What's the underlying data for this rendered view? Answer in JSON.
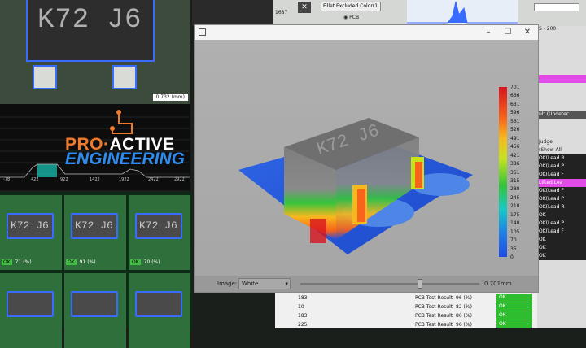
{
  "camera": {
    "chip_marking": "K72 J6",
    "scale_label": "0.732 (mm)"
  },
  "graph": {
    "brand_part1": "PRO",
    "brand_dot": "·",
    "brand_part2": "ACTIVE",
    "brand_line2": "ENGINEERING",
    "axis_ticks": [
      "-78",
      "422",
      "922",
      "1422",
      "1922",
      "2422",
      "2922"
    ]
  },
  "thumbnails": [
    {
      "marking": "K72 J6",
      "score": "71 (%)",
      "status": "OK"
    },
    {
      "marking": "K72 J6",
      "score": "91 (%)",
      "status": "OK"
    },
    {
      "marking": "K72 J6",
      "score": "70 (%)",
      "status": "OK"
    }
  ],
  "background_app": {
    "field_label": "Fillet Excluded Color(1",
    "radio_label": "PCB",
    "code": "1687",
    "range_label": "S - 200"
  },
  "right_panel": {
    "items": [
      "ult (Undetec",
      "Judge",
      "(Show All",
      "OK(Lead R",
      "OK(Lead P",
      "OK(Lead F",
      "Lifted Lea",
      "OK(Lead F",
      "OK(Lead P",
      "OK(Lead R",
      "OK",
      "OK(Lead P",
      "OK(Lead F",
      "OK",
      "OK",
      "OK"
    ]
  },
  "viewer": {
    "window_controls": [
      "–",
      "☐",
      "✕"
    ],
    "colorbar_labels": [
      "701",
      "666",
      "631",
      "596",
      "561",
      "526",
      "491",
      "456",
      "421",
      "386",
      "351",
      "315",
      "280",
      "245",
      "210",
      "175",
      "140",
      "105",
      "70",
      "35",
      "0"
    ],
    "image_label": "Image:",
    "image_select": "White",
    "slider_value": "0.701mm",
    "model_text": "K72 J6",
    "colors": {
      "high": "#d8141f",
      "mid": "#33c43b",
      "low": "#1f4de6"
    }
  },
  "results": {
    "rows": [
      {
        "id": "183",
        "label": "PCB Test Result",
        "pct": "96 (%)",
        "status": "OK"
      },
      {
        "id": "10",
        "label": "PCB Test Result",
        "pct": "82 (%)",
        "status": "OK"
      },
      {
        "id": "183",
        "label": "PCB Test Result",
        "pct": "80 (%)",
        "status": "OK"
      },
      {
        "id": "225",
        "label": "PCB Test Result",
        "pct": "96 (%)",
        "status": "OK"
      }
    ]
  }
}
